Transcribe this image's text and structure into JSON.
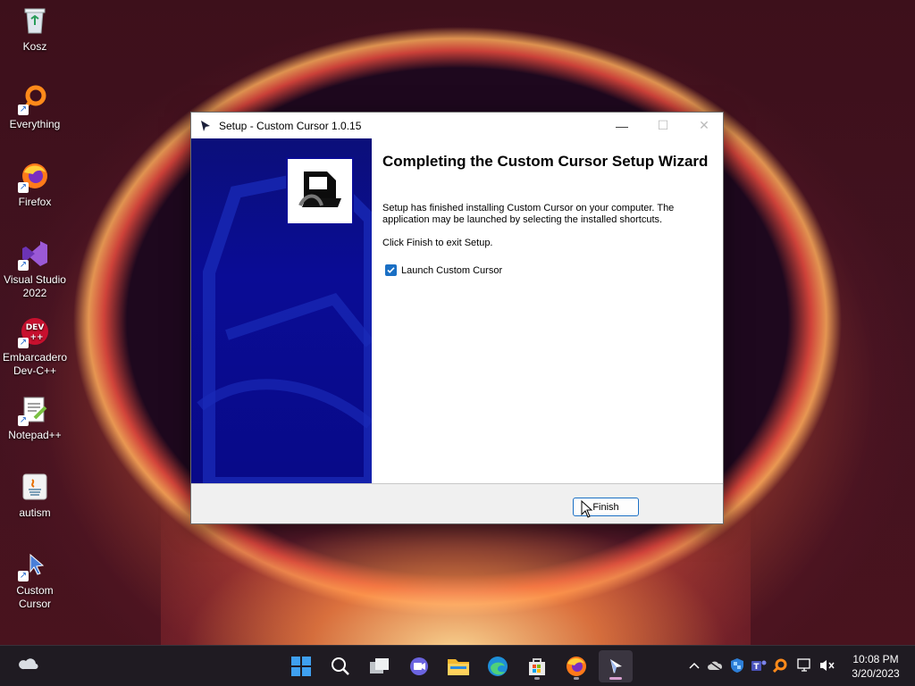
{
  "desktop": {
    "icons": [
      {
        "label": "Kosz"
      },
      {
        "label": "Everything"
      },
      {
        "label": "Firefox"
      },
      {
        "label": "Visual Studio 2022"
      },
      {
        "label": "Embarcadero Dev-C++"
      },
      {
        "label": "Notepad++"
      },
      {
        "label": "autism"
      },
      {
        "label": "Custom Cursor"
      }
    ]
  },
  "window": {
    "title": "Setup - Custom Cursor 1.0.15",
    "heading": "Completing the Custom Cursor Setup Wizard",
    "body": "Setup has finished installing Custom Cursor on your computer. The application may be launched by selecting the installed shortcuts.",
    "exit_text": "Click Finish to exit Setup.",
    "checkbox_label": "Launch Custom Cursor",
    "checkbox_checked": true,
    "finish_label": "Finish"
  },
  "taskbar": {
    "apps": [
      "start",
      "search",
      "task-view",
      "chat",
      "file-explorer",
      "edge",
      "store",
      "firefox",
      "custom-cursor"
    ],
    "active_app": "custom-cursor",
    "time": "10:08 PM",
    "date": "3/20/2023"
  },
  "colors": {
    "accent": "#1a6fc4",
    "sidebar": "#0a0c95",
    "taskbar": "#1f1b22"
  }
}
